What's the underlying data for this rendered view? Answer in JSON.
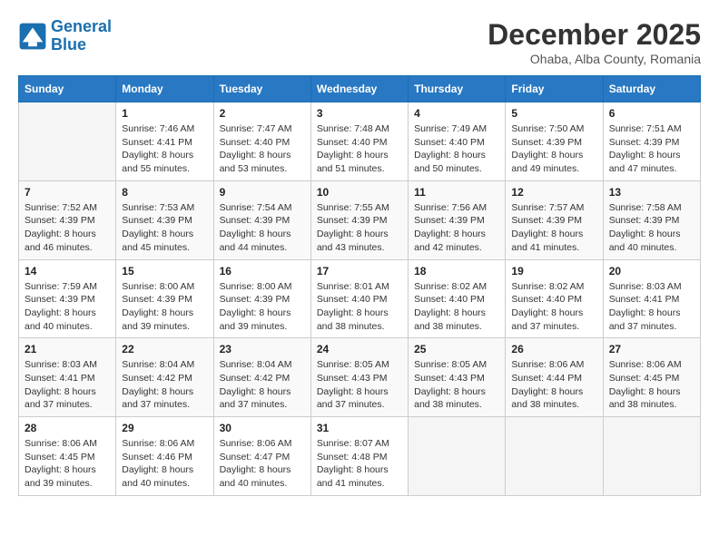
{
  "header": {
    "logo_general": "General",
    "logo_blue": "Blue",
    "month_title": "December 2025",
    "subtitle": "Ohaba, Alba County, Romania"
  },
  "days_of_week": [
    "Sunday",
    "Monday",
    "Tuesday",
    "Wednesday",
    "Thursday",
    "Friday",
    "Saturday"
  ],
  "weeks": [
    [
      {
        "day": "",
        "info": ""
      },
      {
        "day": "1",
        "info": "Sunrise: 7:46 AM\nSunset: 4:41 PM\nDaylight: 8 hours\nand 55 minutes."
      },
      {
        "day": "2",
        "info": "Sunrise: 7:47 AM\nSunset: 4:40 PM\nDaylight: 8 hours\nand 53 minutes."
      },
      {
        "day": "3",
        "info": "Sunrise: 7:48 AM\nSunset: 4:40 PM\nDaylight: 8 hours\nand 51 minutes."
      },
      {
        "day": "4",
        "info": "Sunrise: 7:49 AM\nSunset: 4:40 PM\nDaylight: 8 hours\nand 50 minutes."
      },
      {
        "day": "5",
        "info": "Sunrise: 7:50 AM\nSunset: 4:39 PM\nDaylight: 8 hours\nand 49 minutes."
      },
      {
        "day": "6",
        "info": "Sunrise: 7:51 AM\nSunset: 4:39 PM\nDaylight: 8 hours\nand 47 minutes."
      }
    ],
    [
      {
        "day": "7",
        "info": "Sunrise: 7:52 AM\nSunset: 4:39 PM\nDaylight: 8 hours\nand 46 minutes."
      },
      {
        "day": "8",
        "info": "Sunrise: 7:53 AM\nSunset: 4:39 PM\nDaylight: 8 hours\nand 45 minutes."
      },
      {
        "day": "9",
        "info": "Sunrise: 7:54 AM\nSunset: 4:39 PM\nDaylight: 8 hours\nand 44 minutes."
      },
      {
        "day": "10",
        "info": "Sunrise: 7:55 AM\nSunset: 4:39 PM\nDaylight: 8 hours\nand 43 minutes."
      },
      {
        "day": "11",
        "info": "Sunrise: 7:56 AM\nSunset: 4:39 PM\nDaylight: 8 hours\nand 42 minutes."
      },
      {
        "day": "12",
        "info": "Sunrise: 7:57 AM\nSunset: 4:39 PM\nDaylight: 8 hours\nand 41 minutes."
      },
      {
        "day": "13",
        "info": "Sunrise: 7:58 AM\nSunset: 4:39 PM\nDaylight: 8 hours\nand 40 minutes."
      }
    ],
    [
      {
        "day": "14",
        "info": "Sunrise: 7:59 AM\nSunset: 4:39 PM\nDaylight: 8 hours\nand 40 minutes."
      },
      {
        "day": "15",
        "info": "Sunrise: 8:00 AM\nSunset: 4:39 PM\nDaylight: 8 hours\nand 39 minutes."
      },
      {
        "day": "16",
        "info": "Sunrise: 8:00 AM\nSunset: 4:39 PM\nDaylight: 8 hours\nand 39 minutes."
      },
      {
        "day": "17",
        "info": "Sunrise: 8:01 AM\nSunset: 4:40 PM\nDaylight: 8 hours\nand 38 minutes."
      },
      {
        "day": "18",
        "info": "Sunrise: 8:02 AM\nSunset: 4:40 PM\nDaylight: 8 hours\nand 38 minutes."
      },
      {
        "day": "19",
        "info": "Sunrise: 8:02 AM\nSunset: 4:40 PM\nDaylight: 8 hours\nand 37 minutes."
      },
      {
        "day": "20",
        "info": "Sunrise: 8:03 AM\nSunset: 4:41 PM\nDaylight: 8 hours\nand 37 minutes."
      }
    ],
    [
      {
        "day": "21",
        "info": "Sunrise: 8:03 AM\nSunset: 4:41 PM\nDaylight: 8 hours\nand 37 minutes."
      },
      {
        "day": "22",
        "info": "Sunrise: 8:04 AM\nSunset: 4:42 PM\nDaylight: 8 hours\nand 37 minutes."
      },
      {
        "day": "23",
        "info": "Sunrise: 8:04 AM\nSunset: 4:42 PM\nDaylight: 8 hours\nand 37 minutes."
      },
      {
        "day": "24",
        "info": "Sunrise: 8:05 AM\nSunset: 4:43 PM\nDaylight: 8 hours\nand 37 minutes."
      },
      {
        "day": "25",
        "info": "Sunrise: 8:05 AM\nSunset: 4:43 PM\nDaylight: 8 hours\nand 38 minutes."
      },
      {
        "day": "26",
        "info": "Sunrise: 8:06 AM\nSunset: 4:44 PM\nDaylight: 8 hours\nand 38 minutes."
      },
      {
        "day": "27",
        "info": "Sunrise: 8:06 AM\nSunset: 4:45 PM\nDaylight: 8 hours\nand 38 minutes."
      }
    ],
    [
      {
        "day": "28",
        "info": "Sunrise: 8:06 AM\nSunset: 4:45 PM\nDaylight: 8 hours\nand 39 minutes."
      },
      {
        "day": "29",
        "info": "Sunrise: 8:06 AM\nSunset: 4:46 PM\nDaylight: 8 hours\nand 40 minutes."
      },
      {
        "day": "30",
        "info": "Sunrise: 8:06 AM\nSunset: 4:47 PM\nDaylight: 8 hours\nand 40 minutes."
      },
      {
        "day": "31",
        "info": "Sunrise: 8:07 AM\nSunset: 4:48 PM\nDaylight: 8 hours\nand 41 minutes."
      },
      {
        "day": "",
        "info": ""
      },
      {
        "day": "",
        "info": ""
      },
      {
        "day": "",
        "info": ""
      }
    ]
  ]
}
